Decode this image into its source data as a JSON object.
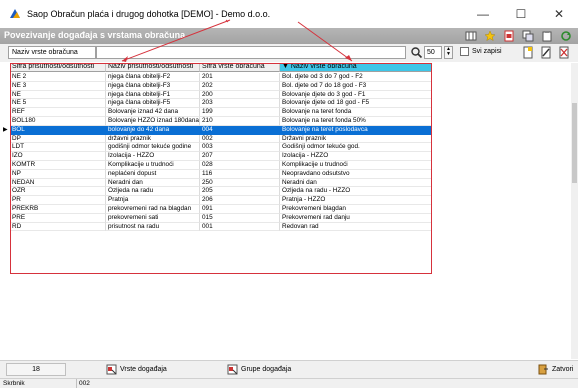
{
  "window": {
    "title": "Saop Obračun plaća i drugog dohotka [DEMO] - Demo d.o.o.",
    "minimize": "—",
    "maximize": "☐",
    "close": "✕"
  },
  "header": {
    "title": "Povezivanje događaja s vrstama obračuna"
  },
  "filter": {
    "field_label": "Naziv vrste obračuna",
    "value": "",
    "count": "50",
    "show_all_label": "Svi zapisi"
  },
  "columns": [
    {
      "label": "Šifra prisutnosti/odsutnosti"
    },
    {
      "label": "Naziv prisutnosti/odsutnosti"
    },
    {
      "label": "Šifra vrste obračuna"
    },
    {
      "label": "▼ Naziv vrste obračuna"
    }
  ],
  "rows": [
    {
      "code": "NE 2",
      "name": "njega člana obitelji-F2",
      "calc_code": "201",
      "calc_name": "Bol. djete od 3 do 7 god - F2"
    },
    {
      "code": "NE 3",
      "name": "njega člana obitelji-F3",
      "calc_code": "202",
      "calc_name": "Bol. djete od 7 do 18 god - F3"
    },
    {
      "code": "NE",
      "name": "njega člana obitelji-F1",
      "calc_code": "200",
      "calc_name": "Bolovanje djete do 3 god - F1"
    },
    {
      "code": "NE 5",
      "name": "njega člana obitelji-F5",
      "calc_code": "203",
      "calc_name": "Bolovanje djete od 18 god - F5"
    },
    {
      "code": "REF",
      "name": "Bolovanje iznad 42 dana",
      "calc_code": "199",
      "calc_name": "Bolovanje na teret fonda"
    },
    {
      "code": "BOL180",
      "name": "Bolovanje HZZO iznad 180dana",
      "calc_code": "210",
      "calc_name": "Bolovanje na teret fonda 50%"
    },
    {
      "code": "BOL",
      "name": "bolovanje do 42 dana",
      "calc_code": "004",
      "calc_name": "Bolovanje na teret poslodavca"
    },
    {
      "code": "DP",
      "name": "državni praznik",
      "calc_code": "002",
      "calc_name": "Državni praznik"
    },
    {
      "code": "LDT",
      "name": "godišnji odmor tekuće godine",
      "calc_code": "003",
      "calc_name": "Godišnji odmor tekuće god."
    },
    {
      "code": "IZO",
      "name": "Izolacija - HZZO",
      "calc_code": "207",
      "calc_name": "Izolacija - HZZO"
    },
    {
      "code": "KOMTR",
      "name": "Komplikacije u trudnoći",
      "calc_code": "028",
      "calc_name": "Komplikacije u trudnoći"
    },
    {
      "code": "NP",
      "name": "neplaćeni dopust",
      "calc_code": "116",
      "calc_name": "Neopravdano odsutstvo"
    },
    {
      "code": "NEDAN",
      "name": "Neradni dan",
      "calc_code": "250",
      "calc_name": "Neradni dan"
    },
    {
      "code": "OZR",
      "name": "Ozljeda na radu",
      "calc_code": "205",
      "calc_name": "Ozljeda na radu - HZZO"
    },
    {
      "code": "PR",
      "name": "Pratnja",
      "calc_code": "206",
      "calc_name": "Pratnja - HZZO"
    },
    {
      "code": "PREKRB",
      "name": "prekovremeni rad na blagdan",
      "calc_code": "091",
      "calc_name": "Prekovremeni blagdan"
    },
    {
      "code": "PRE",
      "name": "prekovremeni sati",
      "calc_code": "015",
      "calc_name": "Prekovremeni rad danju"
    },
    {
      "code": "RD",
      "name": "prisutnost na radu",
      "calc_code": "001",
      "calc_name": "Redovan rad"
    }
  ],
  "selected_row": 6,
  "bottom": {
    "record_count": "18",
    "event_types_button": "Vrste događaja",
    "event_groups_button": "Grupe događaja",
    "close_button": "Zatvori"
  },
  "status": {
    "label": "Skrbnik",
    "value": "002"
  },
  "colors": {
    "selection": "#0a6fd4",
    "sorted_header": "#3ec6e8",
    "highlight_box": "#d6323c"
  }
}
